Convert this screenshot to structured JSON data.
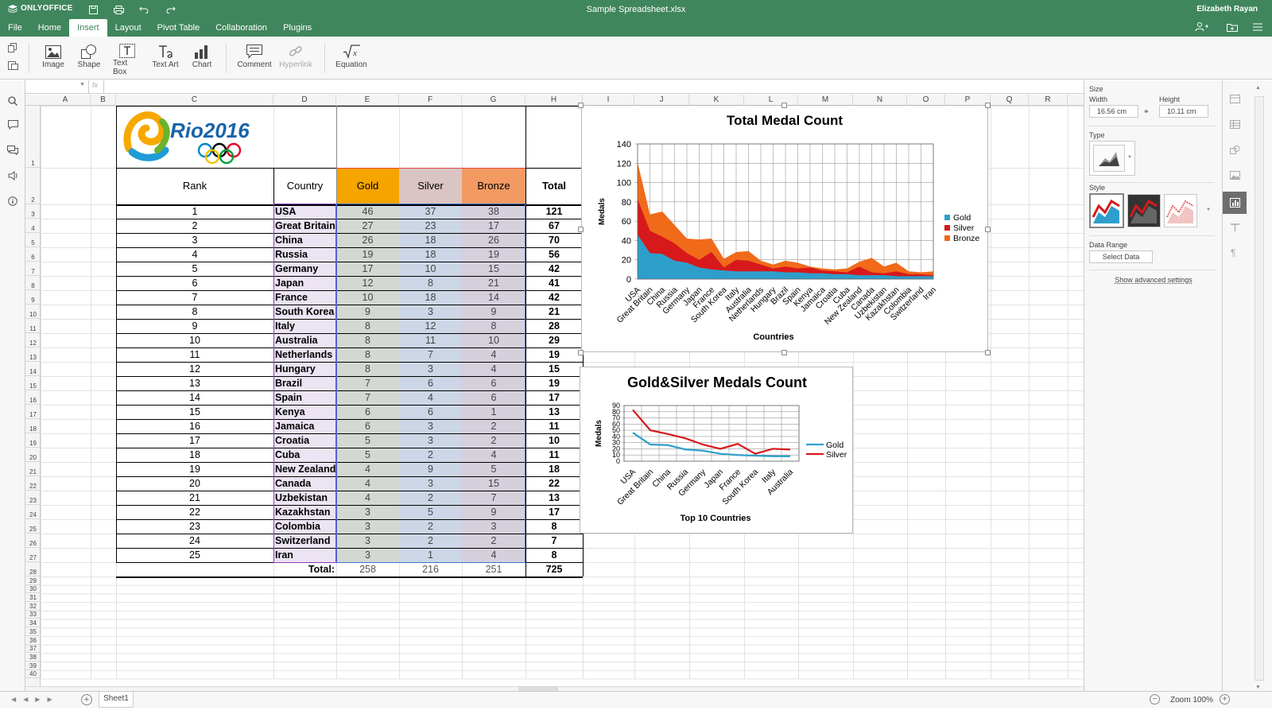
{
  "app": {
    "logo": "ONLYOFFICE",
    "filename": "Sample Spreadsheet.xlsx",
    "user": "Elizabeth Rayan"
  },
  "menu": [
    "File",
    "Home",
    "Insert",
    "Layout",
    "Pivot Table",
    "Collaboration",
    "Plugins"
  ],
  "ribbon": {
    "image": "Image",
    "shape": "Shape",
    "textbox": "Text Box",
    "textart": "Text Art",
    "chart": "Chart",
    "comment": "Comment",
    "hyperlink": "Hyperlink",
    "equation": "Equation"
  },
  "formula": {
    "fx": "fx"
  },
  "columns": [
    "A",
    "B",
    "C",
    "D",
    "E",
    "F",
    "G",
    "H",
    "I",
    "J",
    "K",
    "L",
    "M",
    "N",
    "O",
    "P",
    "Q",
    "R"
  ],
  "rows": [
    "1",
    "2",
    "3",
    "4",
    "5",
    "6",
    "7",
    "8",
    "9",
    "10",
    "11",
    "12",
    "13",
    "14",
    "15",
    "16",
    "17",
    "18",
    "19",
    "20",
    "21",
    "22",
    "23",
    "24",
    "25",
    "26",
    "27",
    "28",
    "29",
    "30",
    "31",
    "32",
    "33",
    "34",
    "35",
    "36",
    "37",
    "38",
    "39",
    "40"
  ],
  "logo_text": "Rio2016",
  "table": {
    "headers": {
      "rank": "Rank",
      "country": "Country",
      "gold": "Gold",
      "silver": "Silver",
      "bronze": "Bronze",
      "total": "Total"
    },
    "rows": [
      [
        "1",
        "USA",
        "46",
        "37",
        "38",
        "121"
      ],
      [
        "2",
        "Great Britain",
        "27",
        "23",
        "17",
        "67"
      ],
      [
        "3",
        "China",
        "26",
        "18",
        "26",
        "70"
      ],
      [
        "4",
        "Russia",
        "19",
        "18",
        "19",
        "56"
      ],
      [
        "5",
        "Germany",
        "17",
        "10",
        "15",
        "42"
      ],
      [
        "6",
        "Japan",
        "12",
        "8",
        "21",
        "41"
      ],
      [
        "7",
        "France",
        "10",
        "18",
        "14",
        "42"
      ],
      [
        "8",
        "South Korea",
        "9",
        "3",
        "9",
        "21"
      ],
      [
        "9",
        "Italy",
        "8",
        "12",
        "8",
        "28"
      ],
      [
        "10",
        "Australia",
        "8",
        "11",
        "10",
        "29"
      ],
      [
        "11",
        "Netherlands",
        "8",
        "7",
        "4",
        "19"
      ],
      [
        "12",
        "Hungary",
        "8",
        "3",
        "4",
        "15"
      ],
      [
        "13",
        "Brazil",
        "7",
        "6",
        "6",
        "19"
      ],
      [
        "14",
        "Spain",
        "7",
        "4",
        "6",
        "17"
      ],
      [
        "15",
        "Kenya",
        "6",
        "6",
        "1",
        "13"
      ],
      [
        "16",
        "Jamaica",
        "6",
        "3",
        "2",
        "11"
      ],
      [
        "17",
        "Croatia",
        "5",
        "3",
        "2",
        "10"
      ],
      [
        "18",
        "Cuba",
        "5",
        "2",
        "4",
        "11"
      ],
      [
        "19",
        "New Zealand",
        "4",
        "9",
        "5",
        "18"
      ],
      [
        "20",
        "Canada",
        "4",
        "3",
        "15",
        "22"
      ],
      [
        "21",
        "Uzbekistan",
        "4",
        "2",
        "7",
        "13"
      ],
      [
        "22",
        "Kazakhstan",
        "3",
        "5",
        "9",
        "17"
      ],
      [
        "23",
        "Colombia",
        "3",
        "2",
        "3",
        "8"
      ],
      [
        "24",
        "Switzerland",
        "3",
        "2",
        "2",
        "7"
      ],
      [
        "25",
        "Iran",
        "3",
        "1",
        "4",
        "8"
      ]
    ],
    "totals": {
      "label": "Total:",
      "gold": "258",
      "silver": "216",
      "bronze": "251",
      "total": "725"
    }
  },
  "chart_data": [
    {
      "type": "area",
      "title": "Total Medal Count",
      "xlabel": "Countries",
      "ylabel": "Medals",
      "ylim": [
        0,
        140
      ],
      "yticks": [
        "0",
        "20",
        "40",
        "60",
        "80",
        "100",
        "120",
        "140"
      ],
      "stacked": true,
      "grid": true,
      "legend": "right",
      "categories": [
        "USA",
        "Great Britain",
        "China",
        "Russia",
        "Germany",
        "Japan",
        "France",
        "South Korea",
        "Italy",
        "Australia",
        "Netherlands",
        "Hungary",
        "Brazil",
        "Spain",
        "Kenya",
        "Jamaica",
        "Croatia",
        "Cuba",
        "New Zealand",
        "Canada",
        "Uzbekistan",
        "Kazakhstan",
        "Colombia",
        "Switzerland",
        "Iran"
      ],
      "series": [
        {
          "name": "Gold",
          "color": "#2e9fcb",
          "values": [
            46,
            27,
            26,
            19,
            17,
            12,
            10,
            9,
            8,
            8,
            8,
            8,
            7,
            7,
            6,
            6,
            5,
            5,
            4,
            4,
            4,
            3,
            3,
            3,
            3
          ]
        },
        {
          "name": "Silver",
          "color": "#d7191c",
          "values": [
            37,
            23,
            18,
            18,
            10,
            8,
            18,
            3,
            12,
            11,
            7,
            3,
            6,
            4,
            6,
            3,
            3,
            2,
            9,
            3,
            2,
            5,
            2,
            2,
            1
          ]
        },
        {
          "name": "Bronze",
          "color": "#f06a1a",
          "values": [
            38,
            17,
            26,
            19,
            15,
            21,
            14,
            9,
            8,
            10,
            4,
            4,
            6,
            6,
            1,
            2,
            2,
            4,
            5,
            15,
            7,
            9,
            3,
            2,
            4
          ]
        }
      ]
    },
    {
      "type": "line",
      "title": "Gold&Silver Medals Count",
      "xlabel": "Top 10 Countries",
      "ylabel": "Medals",
      "ylim": [
        0,
        90
      ],
      "yticks": [
        "0",
        "10",
        "20",
        "30",
        "40",
        "50",
        "60",
        "70",
        "80",
        "90"
      ],
      "grid": true,
      "legend": "right",
      "categories": [
        "USA",
        "Great Britain",
        "China",
        "Russia",
        "Germany",
        "Japan",
        "France",
        "South Korea",
        "Italy",
        "Australia"
      ],
      "series": [
        {
          "name": "Gold",
          "color": "#2e9fcb",
          "values": [
            46,
            27,
            26,
            19,
            17,
            12,
            10,
            9,
            8,
            8
          ]
        },
        {
          "name": "Silver",
          "color": "#d7191c",
          "values": [
            83,
            50,
            44,
            37,
            27,
            20,
            28,
            12,
            20,
            19
          ]
        }
      ]
    }
  ],
  "panel": {
    "size": "Size",
    "width_label": "Width",
    "height_label": "Height",
    "width": "16.56 cm",
    "height": "10.11 cm",
    "type": "Type",
    "style": "Style",
    "data_range": "Data Range",
    "select_data": "Select Data",
    "advanced": "Show advanced settings"
  },
  "status": {
    "sheet": "Sheet1",
    "zoom": "Zoom 100%"
  },
  "colors": {
    "accent": "#40865c",
    "gold": "#f5a400",
    "silver": "#dbc4c4",
    "bronze": "#f39a62",
    "country_bg": "#ece4f3",
    "num_bg": "#cdd6e6"
  }
}
